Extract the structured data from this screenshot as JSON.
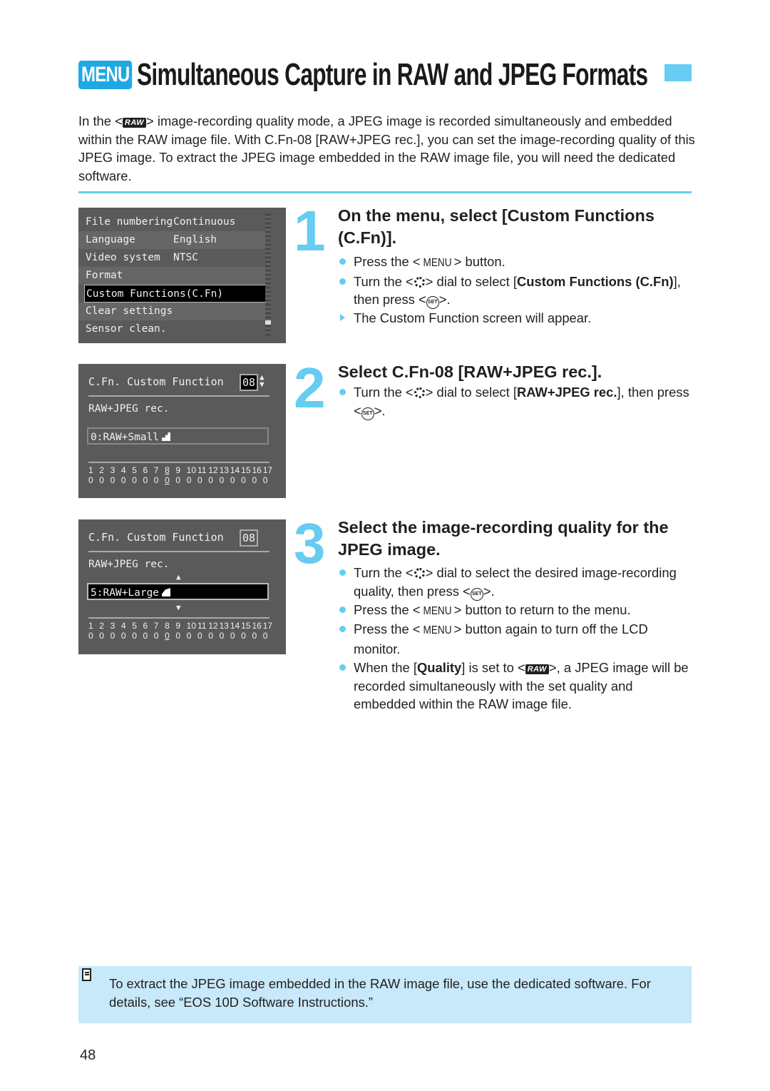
{
  "header": {
    "badge": "MENU",
    "title": "Simultaneous Capture in RAW and JPEG Formats"
  },
  "intro": {
    "before_icon": "In the <",
    "icon": "RAW",
    "after_icon": "> image-recording quality mode, a JPEG image is recorded simultaneously and embedded within the RAW image file. With C.Fn-08 [RAW+JPEG rec.], you can set the image-recording quality of this JPEG image. To extract the JPEG image embedded in the RAW image file, you will need the dedicated software."
  },
  "screen1": {
    "rows": [
      {
        "label": "File numbering",
        "value": "Continuous"
      },
      {
        "label": "Language",
        "value": "English"
      },
      {
        "label": "Video system",
        "value": "NTSC"
      },
      {
        "label": "Format",
        "value": ""
      },
      {
        "label": "Custom Functions(C.Fn)",
        "value": "",
        "selected": true
      },
      {
        "label": "Clear settings",
        "value": ""
      },
      {
        "label": "Sensor clean.",
        "value": ""
      }
    ]
  },
  "screen2": {
    "header": "C.Fn. Custom Function",
    "number": "08",
    "name": "RAW+JPEG rec.",
    "setting": "0:RAW+Small",
    "fn_numbers": [
      "1",
      "2",
      "3",
      "4",
      "5",
      "6",
      "7",
      "8",
      "9",
      "10",
      "11",
      "12",
      "13",
      "14",
      "15",
      "16",
      "17"
    ],
    "fn_values": [
      "0",
      "0",
      "0",
      "0",
      "0",
      "0",
      "0",
      "0",
      "0",
      "0",
      "0",
      "0",
      "0",
      "0",
      "0",
      "0",
      "0"
    ],
    "current_index": 7
  },
  "screen3": {
    "header": "C.Fn. Custom Function",
    "number": "08",
    "name": "RAW+JPEG rec.",
    "setting": "5:RAW+Large",
    "fn_numbers": [
      "1",
      "2",
      "3",
      "4",
      "5",
      "6",
      "7",
      "8",
      "9",
      "10",
      "11",
      "12",
      "13",
      "14",
      "15",
      "16",
      "17"
    ],
    "fn_values": [
      "0",
      "0",
      "0",
      "0",
      "0",
      "0",
      "0",
      "0",
      "0",
      "0",
      "0",
      "0",
      "0",
      "0",
      "0",
      "0",
      "0"
    ],
    "current_index": 7
  },
  "steps": [
    {
      "number": "1",
      "title": "On the menu, select [Custom Functions (C.Fn)].",
      "b1_pre": "Press the <",
      "b1_menu": "MENU",
      "b1_post": "> button.",
      "b2_pre": "Turn the <",
      "b2_mid": "> dial to select [",
      "b2_bold": "Custom Functions (C.Fn)",
      "b2_post": "], then press <",
      "b2_end": ">.",
      "b3": "The Custom Function screen will appear."
    },
    {
      "number": "2",
      "title": "Select C.Fn-08 [RAW+JPEG rec.].",
      "b1_pre": "Turn the <",
      "b1_mid": "> dial to select [",
      "b1_bold": "RAW+JPEG rec.",
      "b1_post": "], then press <",
      "b1_end": ">."
    },
    {
      "number": "3",
      "title": "Select the image-recording quality for the JPEG image.",
      "b1_pre": "Turn the <",
      "b1_mid": "> dial to select the desired image-recording quality, then press <",
      "b1_end": ">.",
      "b2_pre": "Press the <",
      "b2_menu": "MENU",
      "b2_post": "> button to return to the menu.",
      "b3_pre": "Press the <",
      "b3_menu": "MENU",
      "b3_post": "> button again to turn off the LCD monitor.",
      "b4_pre": "When the [",
      "b4_bold": "Quality",
      "b4_mid": "] is set to <",
      "b4_icon": "RAW",
      "b4_post": ">, a JPEG image will be recorded simultaneously with the set quality and embedded within the RAW image file."
    }
  ],
  "icons": {
    "set": "SET"
  },
  "note": {
    "text": "To extract the JPEG image embedded in the RAW image file, use the dedicated software. For details, see “EOS 10D Software Instructions.”"
  },
  "page_number": "48"
}
